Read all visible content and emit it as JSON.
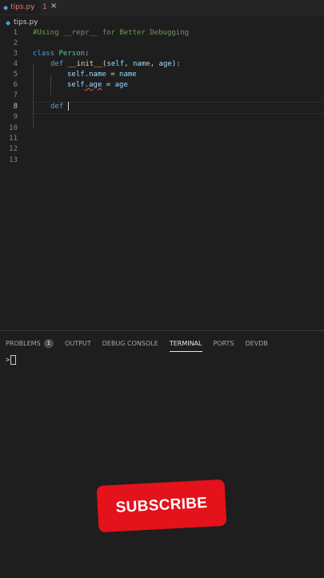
{
  "tab": {
    "filename": "tips.py",
    "problem_count": "1",
    "close_glyph": "×"
  },
  "breadcrumb": {
    "filename": "tips.py"
  },
  "editor": {
    "lines": [
      {
        "n": "1",
        "text": "#Using __repr__ for Better Debugging"
      },
      {
        "n": "2",
        "text": ""
      },
      {
        "n": "3",
        "kw": "class",
        "name": "Person",
        "rest": ":"
      },
      {
        "n": "4",
        "kw": "def",
        "fn": "__init__",
        "rest_open": "(",
        "p1": "self",
        "p2": "name",
        "p3": "age",
        "rest_close": "):"
      },
      {
        "n": "5",
        "a": "self",
        "b": ".name",
        "c": " = ",
        "d": "name"
      },
      {
        "n": "6",
        "a": "self",
        "b": ".age",
        "c": " = ",
        "d": "age"
      },
      {
        "n": "7",
        "text": ""
      },
      {
        "n": "8",
        "kw": "def",
        "text": " "
      },
      {
        "n": "9",
        "text": ""
      },
      {
        "n": "10",
        "text": ""
      },
      {
        "n": "11",
        "text": ""
      },
      {
        "n": "12",
        "text": ""
      },
      {
        "n": "13",
        "text": ""
      }
    ]
  },
  "panel": {
    "tabs": [
      "PROBLEMS",
      "OUTPUT",
      "DEBUG CONSOLE",
      "TERMINAL",
      "PORTS",
      "DEVDB"
    ],
    "problems_badge": "1",
    "active_tab": "TERMINAL",
    "prompt": ">"
  },
  "overlay": {
    "subscribe_label": "SUBSCRIBE"
  },
  "colors": {
    "accent": "#e3121b",
    "background": "#1e1e1e"
  }
}
